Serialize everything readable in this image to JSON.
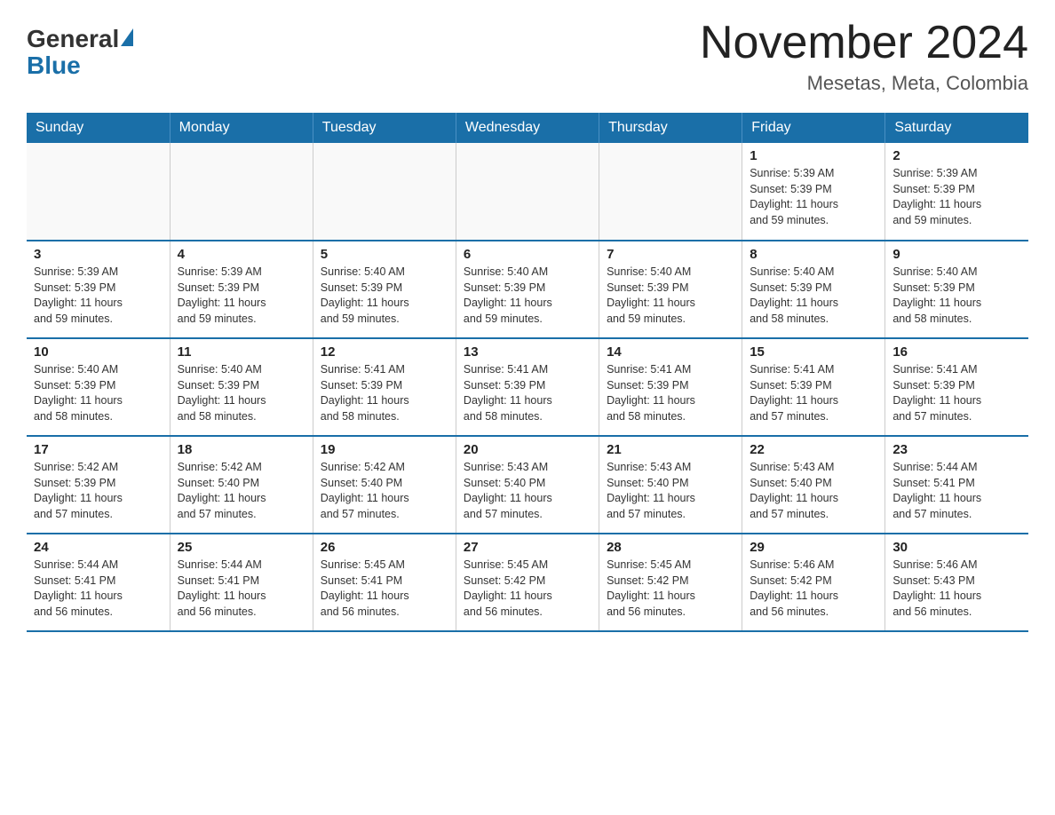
{
  "header": {
    "logo_general": "General",
    "logo_blue": "Blue",
    "title": "November 2024",
    "subtitle": "Mesetas, Meta, Colombia"
  },
  "calendar": {
    "days_of_week": [
      "Sunday",
      "Monday",
      "Tuesday",
      "Wednesday",
      "Thursday",
      "Friday",
      "Saturday"
    ],
    "weeks": [
      [
        {
          "day": "",
          "info": ""
        },
        {
          "day": "",
          "info": ""
        },
        {
          "day": "",
          "info": ""
        },
        {
          "day": "",
          "info": ""
        },
        {
          "day": "",
          "info": ""
        },
        {
          "day": "1",
          "info": "Sunrise: 5:39 AM\nSunset: 5:39 PM\nDaylight: 11 hours\nand 59 minutes."
        },
        {
          "day": "2",
          "info": "Sunrise: 5:39 AM\nSunset: 5:39 PM\nDaylight: 11 hours\nand 59 minutes."
        }
      ],
      [
        {
          "day": "3",
          "info": "Sunrise: 5:39 AM\nSunset: 5:39 PM\nDaylight: 11 hours\nand 59 minutes."
        },
        {
          "day": "4",
          "info": "Sunrise: 5:39 AM\nSunset: 5:39 PM\nDaylight: 11 hours\nand 59 minutes."
        },
        {
          "day": "5",
          "info": "Sunrise: 5:40 AM\nSunset: 5:39 PM\nDaylight: 11 hours\nand 59 minutes."
        },
        {
          "day": "6",
          "info": "Sunrise: 5:40 AM\nSunset: 5:39 PM\nDaylight: 11 hours\nand 59 minutes."
        },
        {
          "day": "7",
          "info": "Sunrise: 5:40 AM\nSunset: 5:39 PM\nDaylight: 11 hours\nand 59 minutes."
        },
        {
          "day": "8",
          "info": "Sunrise: 5:40 AM\nSunset: 5:39 PM\nDaylight: 11 hours\nand 58 minutes."
        },
        {
          "day": "9",
          "info": "Sunrise: 5:40 AM\nSunset: 5:39 PM\nDaylight: 11 hours\nand 58 minutes."
        }
      ],
      [
        {
          "day": "10",
          "info": "Sunrise: 5:40 AM\nSunset: 5:39 PM\nDaylight: 11 hours\nand 58 minutes."
        },
        {
          "day": "11",
          "info": "Sunrise: 5:40 AM\nSunset: 5:39 PM\nDaylight: 11 hours\nand 58 minutes."
        },
        {
          "day": "12",
          "info": "Sunrise: 5:41 AM\nSunset: 5:39 PM\nDaylight: 11 hours\nand 58 minutes."
        },
        {
          "day": "13",
          "info": "Sunrise: 5:41 AM\nSunset: 5:39 PM\nDaylight: 11 hours\nand 58 minutes."
        },
        {
          "day": "14",
          "info": "Sunrise: 5:41 AM\nSunset: 5:39 PM\nDaylight: 11 hours\nand 58 minutes."
        },
        {
          "day": "15",
          "info": "Sunrise: 5:41 AM\nSunset: 5:39 PM\nDaylight: 11 hours\nand 57 minutes."
        },
        {
          "day": "16",
          "info": "Sunrise: 5:41 AM\nSunset: 5:39 PM\nDaylight: 11 hours\nand 57 minutes."
        }
      ],
      [
        {
          "day": "17",
          "info": "Sunrise: 5:42 AM\nSunset: 5:39 PM\nDaylight: 11 hours\nand 57 minutes."
        },
        {
          "day": "18",
          "info": "Sunrise: 5:42 AM\nSunset: 5:40 PM\nDaylight: 11 hours\nand 57 minutes."
        },
        {
          "day": "19",
          "info": "Sunrise: 5:42 AM\nSunset: 5:40 PM\nDaylight: 11 hours\nand 57 minutes."
        },
        {
          "day": "20",
          "info": "Sunrise: 5:43 AM\nSunset: 5:40 PM\nDaylight: 11 hours\nand 57 minutes."
        },
        {
          "day": "21",
          "info": "Sunrise: 5:43 AM\nSunset: 5:40 PM\nDaylight: 11 hours\nand 57 minutes."
        },
        {
          "day": "22",
          "info": "Sunrise: 5:43 AM\nSunset: 5:40 PM\nDaylight: 11 hours\nand 57 minutes."
        },
        {
          "day": "23",
          "info": "Sunrise: 5:44 AM\nSunset: 5:41 PM\nDaylight: 11 hours\nand 57 minutes."
        }
      ],
      [
        {
          "day": "24",
          "info": "Sunrise: 5:44 AM\nSunset: 5:41 PM\nDaylight: 11 hours\nand 56 minutes."
        },
        {
          "day": "25",
          "info": "Sunrise: 5:44 AM\nSunset: 5:41 PM\nDaylight: 11 hours\nand 56 minutes."
        },
        {
          "day": "26",
          "info": "Sunrise: 5:45 AM\nSunset: 5:41 PM\nDaylight: 11 hours\nand 56 minutes."
        },
        {
          "day": "27",
          "info": "Sunrise: 5:45 AM\nSunset: 5:42 PM\nDaylight: 11 hours\nand 56 minutes."
        },
        {
          "day": "28",
          "info": "Sunrise: 5:45 AM\nSunset: 5:42 PM\nDaylight: 11 hours\nand 56 minutes."
        },
        {
          "day": "29",
          "info": "Sunrise: 5:46 AM\nSunset: 5:42 PM\nDaylight: 11 hours\nand 56 minutes."
        },
        {
          "day": "30",
          "info": "Sunrise: 5:46 AM\nSunset: 5:43 PM\nDaylight: 11 hours\nand 56 minutes."
        }
      ]
    ]
  }
}
